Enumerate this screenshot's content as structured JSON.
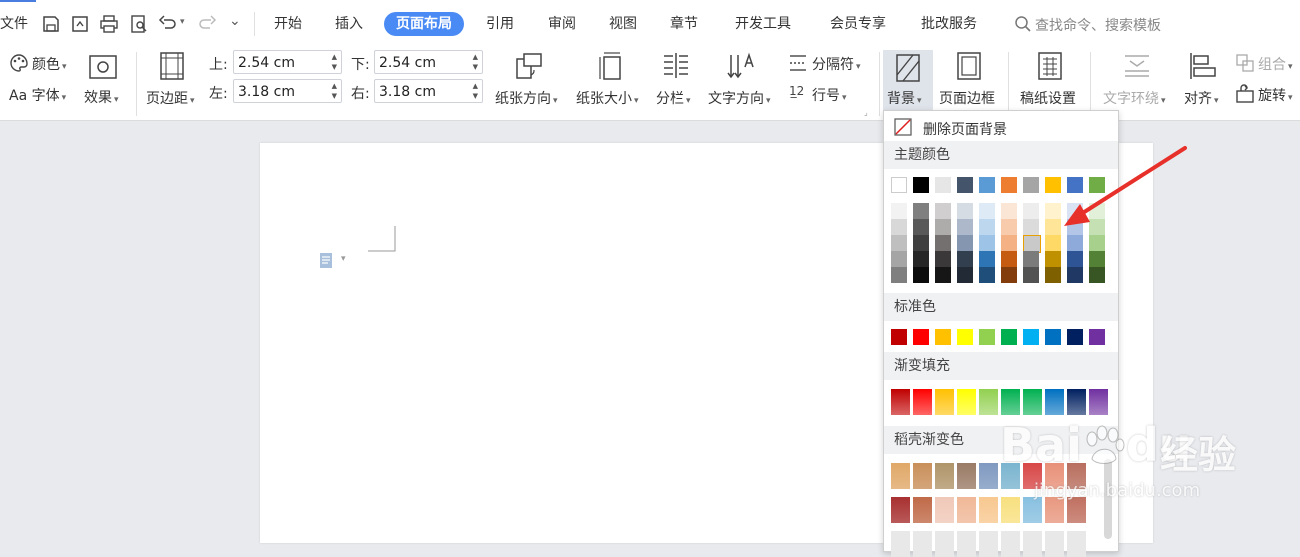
{
  "tabs": {
    "file": "文件",
    "start": "开始",
    "insert": "插入",
    "layout": "页面布局",
    "reference": "引用",
    "review": "审阅",
    "view": "视图",
    "chapter": "章节",
    "devtools": "开发工具",
    "member": "会员专享",
    "approve": "批改服务"
  },
  "search": {
    "placeholder": "查找命令、搜索模板"
  },
  "ribbon": {
    "color": "颜色",
    "font": "字体",
    "font_prefix": "Aa",
    "effect": "效果",
    "margins": "页边距",
    "top_label": "上:",
    "top_value": "2.54 cm",
    "bottom_label": "下:",
    "bottom_value": "2.54 cm",
    "left_label": "左:",
    "left_value": "3.18 cm",
    "right_label": "右:",
    "right_value": "3.18 cm",
    "orientation": "纸张方向",
    "size": "纸张大小",
    "columns": "分栏",
    "text_direction": "文字方向",
    "break": "分隔符",
    "line_number": "行号",
    "background": "背景",
    "page_border": "页面边框",
    "draft_paper": "稿纸设置",
    "text_wrap": "文字环绕",
    "align": "对齐",
    "group": "组合",
    "rotate": "旋转"
  },
  "menu": {
    "remove_bg": "删除页面背景",
    "theme_colors": "主题颜色",
    "standard_colors": "标准色",
    "gradient_fill": "渐变填充",
    "docer_gradient": "稻壳渐变色"
  },
  "colors": {
    "accent": "#4a8af4",
    "theme_row": [
      "#ffffff",
      "#000000",
      "#e7e6e6",
      "#44546a",
      "#5b9bd5",
      "#ed7d31",
      "#a5a5a5",
      "#ffc000",
      "#4472c4",
      "#70ad47"
    ],
    "theme_tints": [
      [
        "#f2f2f2",
        "#7f7f7f",
        "#d0cece",
        "#d6dce4",
        "#deebf6",
        "#fbe5d5",
        "#ededed",
        "#fff2cc",
        "#dae3f3",
        "#e2efd9"
      ],
      [
        "#d8d8d8",
        "#595959",
        "#aeabab",
        "#adb9ca",
        "#bdd7ee",
        "#f8cbad",
        "#dbdbdb",
        "#ffe598",
        "#b4c6e7",
        "#c5e0b3"
      ],
      [
        "#bfbfbf",
        "#3f3f3f",
        "#757070",
        "#8496b0",
        "#9dc3e6",
        "#f4b183",
        "#c9c9c9",
        "#ffd965",
        "#8eaadb",
        "#a8d08d"
      ],
      [
        "#a5a5a5",
        "#262626",
        "#3a3838",
        "#323f4f",
        "#2e75b5",
        "#c55a11",
        "#7b7b7b",
        "#bf9000",
        "#2f5496",
        "#538135"
      ],
      [
        "#7f7f7f",
        "#0c0c0c",
        "#171616",
        "#222a35",
        "#1e4e79",
        "#833c0b",
        "#525252",
        "#7f6000",
        "#1f3864",
        "#375623"
      ]
    ],
    "standard": [
      "#c00000",
      "#ff0000",
      "#ffc000",
      "#ffff00",
      "#92d050",
      "#00b050",
      "#00b0f0",
      "#0070c0",
      "#002060",
      "#7030a0"
    ],
    "gradient": [
      "#c00000",
      "#ff0000",
      "#ffc000",
      "#ffff00",
      "#92d050",
      "#00b050",
      "#00b050",
      "#0070c0",
      "#002060",
      "#7030a0"
    ],
    "docer_row1": [
      "#e0a868",
      "#c98f5a",
      "#b0956a",
      "#9a7b66",
      "#7f99c0",
      "#7ab4cf",
      "#d84848",
      "#e89078",
      "#b86e5e"
    ],
    "docer_row2": [
      "#a83030",
      "#c06a48",
      "#f0c8b8",
      "#f0b898",
      "#f8c890",
      "#f8e080",
      "#88c0e0",
      "#e89880",
      "#c07060"
    ]
  },
  "watermark": {
    "brand": "Bai",
    "brand_icon": "paw-icon",
    "brand_suffix": "du",
    "cn": "经验",
    "url": "jingyan.baidu.com"
  }
}
